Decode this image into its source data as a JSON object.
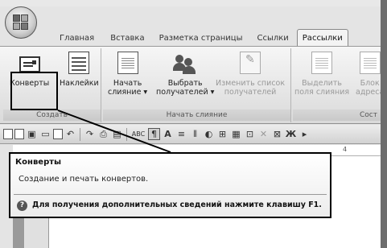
{
  "tabs": [
    {
      "label": "Главная",
      "active": false
    },
    {
      "label": "Вставка",
      "active": false
    },
    {
      "label": "Разметка страницы",
      "active": false
    },
    {
      "label": "Ссылки",
      "active": false
    },
    {
      "label": "Рассылки",
      "active": true
    }
  ],
  "ribbon": {
    "groups": {
      "create": {
        "label": "Создать",
        "envelopes": "Конверты",
        "labels": "Наклейки"
      },
      "start_merge": {
        "label": "Начать слияние",
        "start_line1": "Начать",
        "start_line2": "слияние ▾",
        "select_line1": "Выбрать",
        "select_line2": "получателей ▾",
        "edit_line1": "Изменить список",
        "edit_line2": "получателей"
      },
      "fields": {
        "label": "Сост",
        "highlight_line1": "Выделить",
        "highlight_line2": "поля слияния",
        "block_line1": "Блок",
        "block_line2": "адреса"
      }
    }
  },
  "ruler": {
    "mark": "4"
  },
  "tooltip": {
    "title": "Конверты",
    "description": "Создание и печать конвертов.",
    "help_icon": "?",
    "help": "Для получения дополнительных сведений нажмите клавишу F1."
  },
  "qat": {
    "symbols": [
      "ABC",
      "¶",
      "A",
      "Ж"
    ]
  },
  "colors": {
    "ribbon_bg": "#e6e6e6",
    "highlight": "#000000"
  }
}
